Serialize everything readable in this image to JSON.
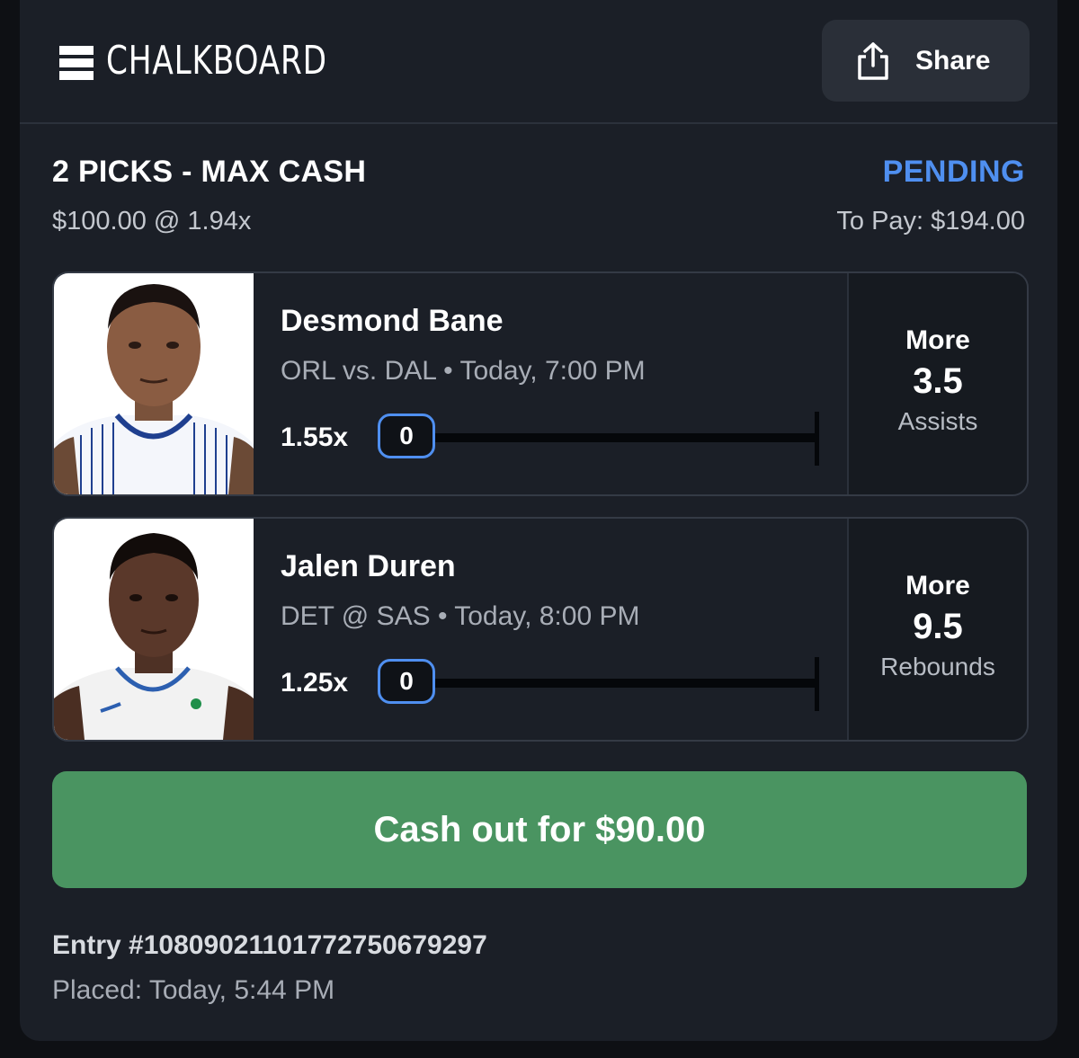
{
  "header": {
    "logo_text": "CHALKBOARD",
    "share_label": "Share"
  },
  "entry_summary": {
    "title": "2 PICKS - MAX CASH",
    "status": "PENDING",
    "stake": "$100.00 @ 1.94x",
    "to_pay": "To Pay: $194.00"
  },
  "picks": [
    {
      "player": "Desmond Bane",
      "game": "ORL vs. DAL • Today, 7:00 PM",
      "multiplier": "1.55x",
      "current": "0",
      "progress": 0,
      "direction": "More",
      "line": "3.5",
      "stat": "Assists",
      "jersey_color": "#ffffff",
      "accent": "#1f3f8f"
    },
    {
      "player": "Jalen Duren",
      "game": "DET @ SAS • Today, 8:00 PM",
      "multiplier": "1.25x",
      "current": "0",
      "progress": 0,
      "direction": "More",
      "line": "9.5",
      "stat": "Rebounds",
      "jersey_color": "#f2f2f2",
      "accent": "#2c5fb0"
    }
  ],
  "cashout": {
    "label": "Cash out for $90.00",
    "color": "#4a9461"
  },
  "footer": {
    "entry_id": "Entry #1080902110177275067929​7",
    "placed": "Placed: Today, 5:44 PM"
  },
  "colors": {
    "status": "#4f8ff0",
    "background": "#1b1f27"
  }
}
